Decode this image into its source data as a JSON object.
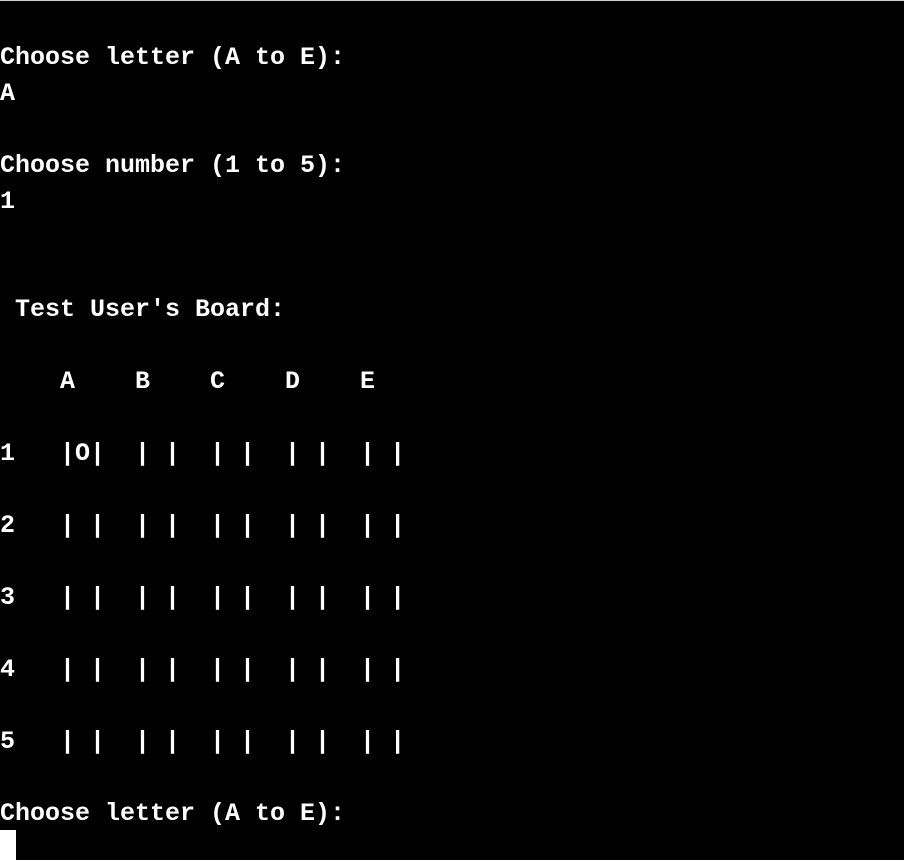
{
  "terminal": {
    "lines": [
      "Choose letter (A to E):",
      "A",
      "",
      "Choose number (1 to 5):",
      "1",
      "",
      "",
      " Test User's Board:",
      "",
      "    A    B    C    D    E",
      "",
      "1   |O|  | |  | |  | |  | |",
      "",
      "2   | |  | |  | |  | |  | |",
      "",
      "3   | |  | |  | |  | |  | |",
      "",
      "4   | |  | |  | |  | |  | |",
      "",
      "5   | |  | |  | |  | |  | |",
      "",
      "Choose letter (A to E):"
    ]
  }
}
